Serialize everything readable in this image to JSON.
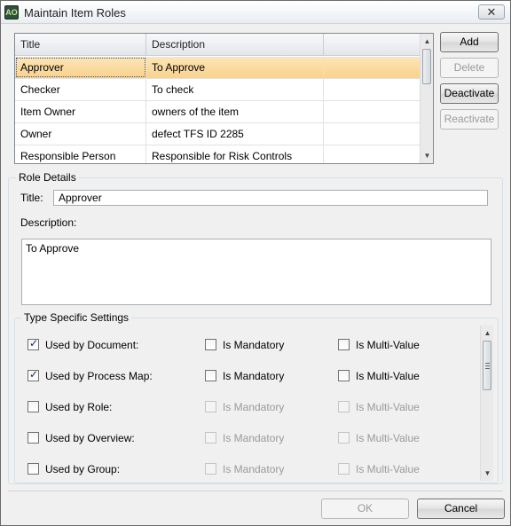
{
  "window": {
    "title": "Maintain Item Roles",
    "close_glyph": "✕",
    "icon_text": "AO"
  },
  "grid": {
    "columns": [
      "Title",
      "Description",
      ""
    ],
    "rows": [
      {
        "title": "Approver",
        "description": "To Approve",
        "selected": true
      },
      {
        "title": "Checker",
        "description": "To check",
        "selected": false
      },
      {
        "title": "Item Owner",
        "description": "owners of the item",
        "selected": false
      },
      {
        "title": "Owner",
        "description": "defect TFS ID 2285",
        "selected": false
      },
      {
        "title": "Responsible Person",
        "description": "Responsible for Risk Controls",
        "selected": false
      }
    ]
  },
  "buttons": {
    "add": "Add",
    "delete": "Delete",
    "deactivate": "Deactivate",
    "reactivate": "Reactivate",
    "ok": "OK",
    "cancel": "Cancel"
  },
  "role_details": {
    "legend": "Role Details",
    "title_label": "Title:",
    "title_value": "Approver",
    "description_label": "Description:",
    "description_value": "To Approve"
  },
  "type_settings": {
    "legend": "Type Specific Settings",
    "mandatory_label": "Is Mandatory",
    "multivalue_label": "Is Multi-Value",
    "rows": [
      {
        "label": "Used by Document:",
        "used": true,
        "mandatory": false,
        "multi": false,
        "enabled": true
      },
      {
        "label": "Used by Process Map:",
        "used": true,
        "mandatory": false,
        "multi": false,
        "enabled": true
      },
      {
        "label": "Used by Role:",
        "used": false,
        "mandatory": false,
        "multi": false,
        "enabled": false
      },
      {
        "label": "Used by Overview:",
        "used": false,
        "mandatory": false,
        "multi": false,
        "enabled": false
      },
      {
        "label": "Used by Group:",
        "used": false,
        "mandatory": false,
        "multi": false,
        "enabled": false
      }
    ]
  }
}
